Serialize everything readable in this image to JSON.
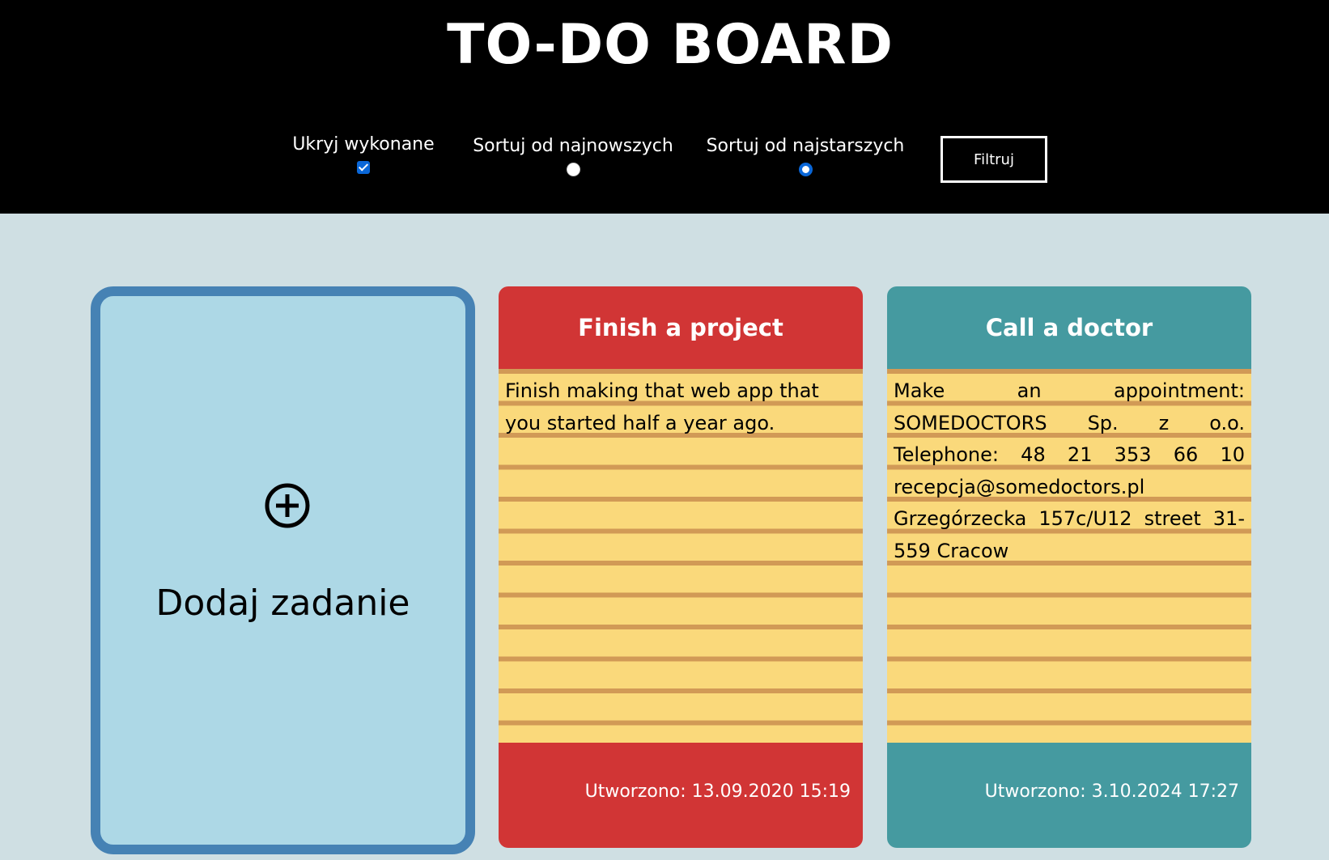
{
  "header": {
    "title": "TO-DO BOARD"
  },
  "filters": {
    "hide_done_label": "Ukryj wykonane",
    "hide_done_checked": true,
    "sort_newest_label": "Sortuj od najnowszych",
    "sort_newest_selected": false,
    "sort_oldest_label": "Sortuj od najstarszych",
    "sort_oldest_selected": true,
    "filter_button_label": "Filtruj"
  },
  "add_card": {
    "icon": "plus-circle-icon",
    "label": "Dodaj zadanie",
    "colors": {
      "background": "#add8e6",
      "border": "#4682b4"
    }
  },
  "tasks": [
    {
      "title": "Finish a project",
      "description": "Finish making that web app that you started half a year ago.",
      "created": "Utworzono: 13.09.2020 15:19",
      "color": "#d13535"
    },
    {
      "title": "Call a doctor",
      "description": "Make an appointment: SOMEDOCTORS Sp. z o.o. Telephone: 48 21 353 66 10 recepcja@somedoctors.pl Grzegórzecka 157c/U12 street 31-559 Cracow",
      "created": "Utworzono: 3.10.2024 17:27",
      "color": "#459aa0"
    }
  ],
  "note_colors": {
    "paper": "#fad97b",
    "line": "#d19a56"
  }
}
